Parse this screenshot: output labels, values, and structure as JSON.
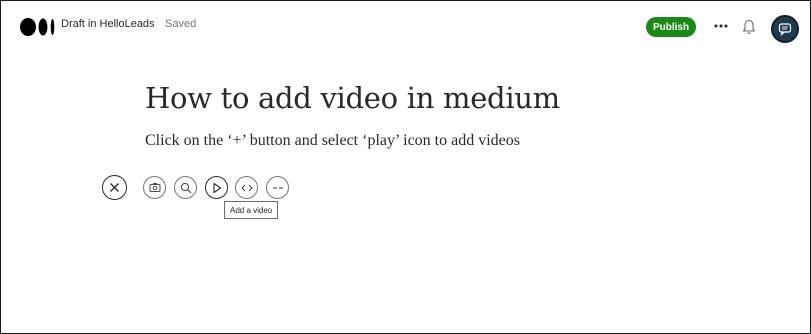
{
  "header": {
    "draft_label": "Draft in HelloLeads",
    "status": "Saved",
    "publish_label": "Publish"
  },
  "post": {
    "title": "How to add video in medium",
    "body": "Click on the ‘+’ button and select ‘play’ icon to add videos"
  },
  "insert_toolbar": {
    "tools": [
      "camera-icon",
      "search-icon",
      "play-icon",
      "embed-icon",
      "divider-icon"
    ],
    "tooltip": "Add a video"
  },
  "colors": {
    "publish": "#1a8917",
    "text": "#292929",
    "muted": "#757575"
  }
}
